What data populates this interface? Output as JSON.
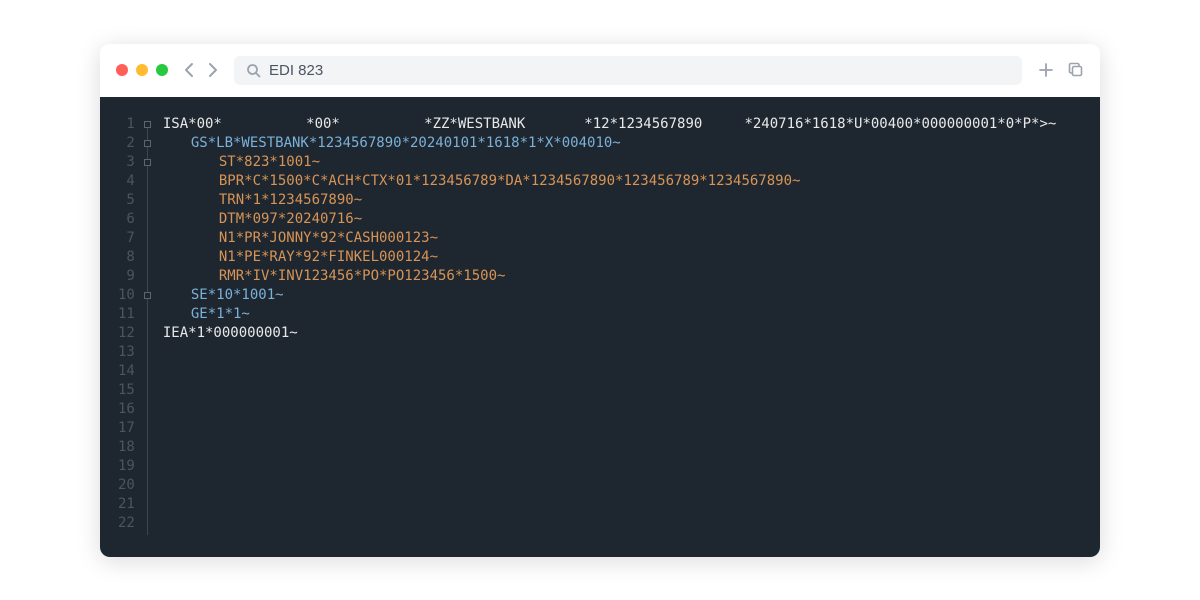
{
  "titlebar": {
    "search_value": "EDI 823"
  },
  "editor": {
    "line_count": 22,
    "fold_markers": [
      1,
      2,
      3,
      10
    ],
    "lines": [
      {
        "indent": 0,
        "color": "white",
        "text": "ISA*00*          *00*          *ZZ*WESTBANK       *12*1234567890     *240716*1618*U*00400*000000001*0*P*>~"
      },
      {
        "indent": 1,
        "color": "blue",
        "text": "GS*LB*WESTBANK*1234567890*20240101*1618*1*X*004010~"
      },
      {
        "indent": 2,
        "color": "orange",
        "text": "ST*823*1001~"
      },
      {
        "indent": 2,
        "color": "orange",
        "text": "BPR*C*1500*C*ACH*CTX*01*123456789*DA*1234567890*123456789*1234567890~"
      },
      {
        "indent": 2,
        "color": "orange",
        "text": "TRN*1*1234567890~"
      },
      {
        "indent": 2,
        "color": "orange",
        "text": "DTM*097*20240716~"
      },
      {
        "indent": 2,
        "color": "orange",
        "text": "N1*PR*JONNY*92*CASH000123~"
      },
      {
        "indent": 2,
        "color": "orange",
        "text": "N1*PE*RAY*92*FINKEL000124~"
      },
      {
        "indent": 2,
        "color": "orange",
        "text": "RMR*IV*INV123456*PO*PO123456*1500~"
      },
      {
        "indent": 1,
        "color": "blue",
        "text": "SE*10*1001~"
      },
      {
        "indent": 1,
        "color": "blue",
        "text": "GE*1*1~"
      },
      {
        "indent": 0,
        "color": "white",
        "text": "IEA*1*000000001~"
      }
    ]
  }
}
